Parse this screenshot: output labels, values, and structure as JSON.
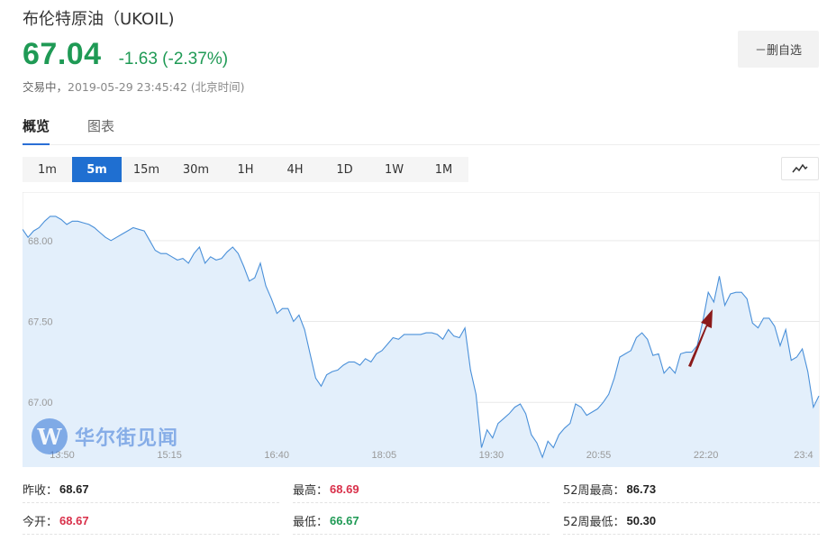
{
  "header": {
    "title": "布伦特原油（UKOIL)",
    "price": "67.04",
    "change": "-1.63 (-2.37%)",
    "status_prefix": "交易中，",
    "timestamp": "2019-05-29 23:45:42 (北京时间)",
    "watch_button": "－删自选"
  },
  "tabs": [
    {
      "label": "概览",
      "active": true
    },
    {
      "label": "图表",
      "active": false
    }
  ],
  "periods": [
    {
      "label": "1m",
      "active": false
    },
    {
      "label": "5m",
      "active": true
    },
    {
      "label": "15m",
      "active": false
    },
    {
      "label": "30m",
      "active": false
    },
    {
      "label": "1H",
      "active": false
    },
    {
      "label": "4H",
      "active": false
    },
    {
      "label": "1D",
      "active": false
    },
    {
      "label": "1W",
      "active": false
    },
    {
      "label": "1M",
      "active": false
    }
  ],
  "chart_type_icon": "line-chart-icon",
  "watermark": {
    "logo_letter": "W",
    "text": "华尔街见闻"
  },
  "colors": {
    "price_green": "#1f9a55",
    "accent_blue": "#1f6fd1",
    "line": "#4a90d9",
    "area": "#e3effb",
    "high_red": "#d9304a",
    "annotation_arrow": "#8b1a1a"
  },
  "chart_data": {
    "type": "area",
    "x_ticks": [
      "13:50",
      "15:15",
      "16:40",
      "18:05",
      "19:30",
      "20:55",
      "22:20",
      "23:4"
    ],
    "y_ticks": [
      "68.00",
      "67.50",
      "67.00"
    ],
    "ylim": [
      66.6,
      68.3
    ],
    "grid": true,
    "series": [
      {
        "values": [
          68.07,
          68.02,
          68.06,
          68.08,
          68.12,
          68.15,
          68.15,
          68.13,
          68.1,
          68.12,
          68.12,
          68.11,
          68.1,
          68.08,
          68.05,
          68.02,
          68.0,
          68.02,
          68.04,
          68.06,
          68.08,
          68.07,
          68.06,
          68.0,
          67.94,
          67.92,
          67.92,
          67.9,
          67.88,
          67.89,
          67.86,
          67.92,
          67.96,
          67.86,
          67.9,
          67.88,
          67.89,
          67.93,
          67.96,
          67.92,
          67.84,
          67.75,
          67.77,
          67.86,
          67.72,
          67.64,
          67.55,
          67.58,
          67.58,
          67.5,
          67.54,
          67.45,
          67.3,
          67.15,
          67.1,
          67.17,
          67.19,
          67.2,
          67.23,
          67.25,
          67.25,
          67.23,
          67.27,
          67.25,
          67.3,
          67.32,
          67.36,
          67.4,
          67.39,
          67.42,
          67.42,
          67.42,
          67.42,
          67.43,
          67.43,
          67.42,
          67.39,
          67.45,
          67.41,
          67.4,
          67.46,
          67.2,
          67.05,
          66.72,
          66.83,
          66.78,
          66.87,
          66.9,
          66.93,
          66.97,
          66.99,
          66.93,
          66.8,
          66.75,
          66.66,
          66.76,
          66.72,
          66.8,
          66.84,
          66.87,
          66.99,
          66.97,
          66.92,
          66.94,
          66.96,
          67.0,
          67.05,
          67.15,
          67.28,
          67.3,
          67.32,
          67.4,
          67.43,
          67.39,
          67.29,
          67.3,
          67.18,
          67.22,
          67.18,
          67.3,
          67.31,
          67.31,
          67.35,
          67.5,
          67.68,
          67.62,
          67.78,
          67.6,
          67.67,
          67.68,
          67.68,
          67.64,
          67.49,
          67.46,
          67.52,
          67.52,
          67.47,
          67.35,
          67.45,
          67.26,
          67.28,
          67.33,
          67.19,
          66.97,
          67.04
        ]
      }
    ]
  },
  "stats": [
    {
      "label": "昨收：",
      "value": "68.67",
      "tone": "dark"
    },
    {
      "label": "最高：",
      "value": "68.69",
      "tone": "red"
    },
    {
      "label": "52周最高：",
      "value": "86.73",
      "tone": "dark"
    },
    {
      "label": "今开：",
      "value": "68.67",
      "tone": "red"
    },
    {
      "label": "最低：",
      "value": "66.67",
      "tone": "green"
    },
    {
      "label": "52周最低：",
      "value": "50.30",
      "tone": "dark"
    }
  ]
}
